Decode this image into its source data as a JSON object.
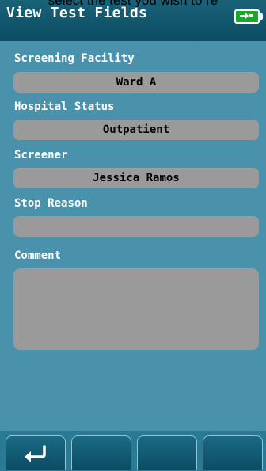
{
  "instruction_cutoff": "select the test you wish to re",
  "title_bar": {
    "title": "View Test Fields",
    "battery_icon": "battery-charging-icon",
    "battery_color": "#1aa82c"
  },
  "fields": [
    {
      "label": "Screening Facility",
      "value": "Ward A"
    },
    {
      "label": "Hospital Status",
      "value": "Outpatient"
    },
    {
      "label": "Screener",
      "value": "Jessica Ramos"
    },
    {
      "label": "Stop Reason",
      "value": ""
    }
  ],
  "comment": {
    "label": "Comment",
    "value": ""
  },
  "softkeys": [
    {
      "icon": "return-arrow-icon"
    },
    {
      "icon": ""
    },
    {
      "icon": ""
    },
    {
      "icon": ""
    }
  ],
  "colors": {
    "background": "#4a92ab",
    "title_bar": "#0c4c62",
    "field_box": "#9a9a9a"
  }
}
